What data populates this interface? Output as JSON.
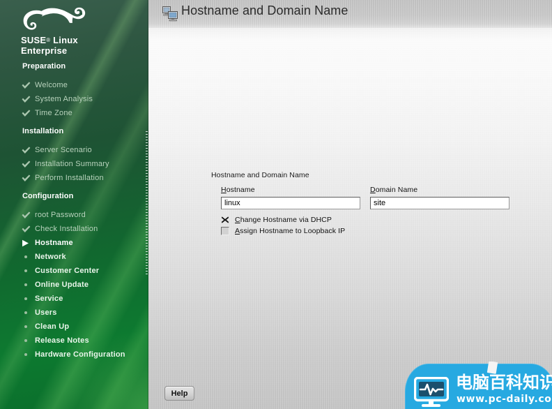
{
  "sidebar": {
    "brand_line1": "SUSE",
    "brand_reg": "®",
    "brand_line1b": " Linux",
    "brand_line2": "Enterprise",
    "logo_icon": "suse-chameleon-logo",
    "sections": [
      {
        "heading": "Preparation",
        "items": [
          {
            "label": "Welcome",
            "state": "done",
            "marker": "check-icon"
          },
          {
            "label": "System Analysis",
            "state": "done",
            "marker": "check-icon"
          },
          {
            "label": "Time Zone",
            "state": "done",
            "marker": "check-icon"
          }
        ]
      },
      {
        "heading": "Installation",
        "items": [
          {
            "label": "Server Scenario",
            "state": "done",
            "marker": "check-icon"
          },
          {
            "label": "Installation Summary",
            "state": "done",
            "marker": "check-icon"
          },
          {
            "label": "Perform Installation",
            "state": "done",
            "marker": "check-icon"
          }
        ]
      },
      {
        "heading": "Configuration",
        "items": [
          {
            "label": "root Password",
            "state": "done",
            "marker": "check-icon"
          },
          {
            "label": "Check Installation",
            "state": "done",
            "marker": "check-icon"
          },
          {
            "label": "Hostname",
            "state": "current",
            "marker": "play-arrow-icon"
          },
          {
            "label": "Network",
            "state": "todo",
            "marker": "bullet-icon"
          },
          {
            "label": "Customer Center",
            "state": "todo",
            "marker": "bullet-icon"
          },
          {
            "label": "Online Update",
            "state": "todo",
            "marker": "bullet-icon"
          },
          {
            "label": "Service",
            "state": "todo",
            "marker": "bullet-icon"
          },
          {
            "label": "Users",
            "state": "todo",
            "marker": "bullet-icon"
          },
          {
            "label": "Clean Up",
            "state": "todo",
            "marker": "bullet-icon"
          },
          {
            "label": "Release Notes",
            "state": "todo",
            "marker": "bullet-icon"
          },
          {
            "label": "Hardware Configuration",
            "state": "todo",
            "marker": "bullet-icon"
          }
        ]
      }
    ]
  },
  "header": {
    "title": "Hostname and Domain Name",
    "icon": "networked-computers-icon"
  },
  "main": {
    "group_title": "Hostname and Domain Name",
    "hostname": {
      "label_mnemonic": "H",
      "label_rest": "ostname",
      "value": "linux",
      "placeholder": ""
    },
    "domain": {
      "label_mnemonic": "D",
      "label_rest": "omain Name",
      "value": "site",
      "placeholder": ""
    },
    "checkboxes": [
      {
        "label_mnemonic": "C",
        "label_rest": "hange Hostname via DHCP",
        "checked": true,
        "icon": "x-check-icon"
      },
      {
        "label_mnemonic": "A",
        "label_rest": "ssign Hostname to Loopback IP",
        "checked": false,
        "icon": "empty-checkbox-icon"
      }
    ]
  },
  "footer": {
    "help_label": "Help"
  },
  "watermark": {
    "cn_text": "电脑百科知识",
    "url_text": "www.pc-daily.com",
    "icon": "monitor-heartbeat-icon",
    "color": "#27a9e1"
  },
  "colors": {
    "sidebar_dark_green": "#1e5334",
    "sidebar_bright_green": "#0d7a30",
    "main_bg_top": "#fbfbfb",
    "main_bg_bottom": "#c2c2c2",
    "header_grey": "#c4c4c4",
    "watermark_blue": "#27a9e1"
  }
}
